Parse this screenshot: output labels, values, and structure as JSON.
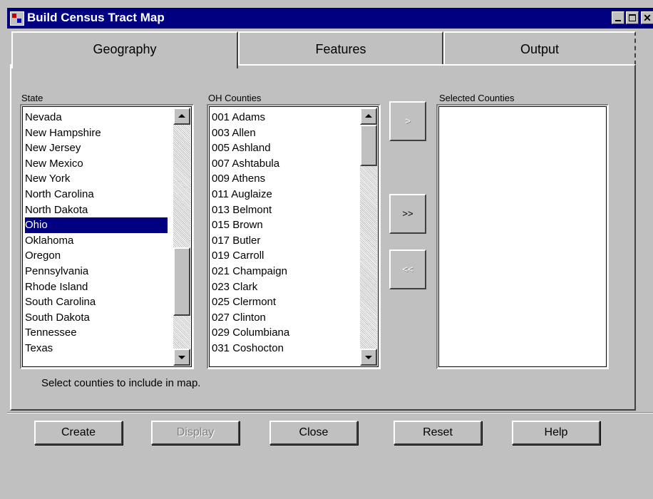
{
  "window": {
    "title": "Build Census Tract Map"
  },
  "tabs": [
    {
      "label": "Geography",
      "active": true
    },
    {
      "label": "Features",
      "active": false
    },
    {
      "label": "Output",
      "active": false
    }
  ],
  "state_group": {
    "label": "State",
    "items": [
      "Nevada",
      "New Hampshire",
      "New Jersey",
      "New Mexico",
      "New York",
      "North Carolina",
      "North Dakota",
      "Ohio",
      "Oklahoma",
      "Oregon",
      "Pennsylvania",
      "Rhode Island",
      "South Carolina",
      "South Dakota",
      "Tennessee",
      "Texas"
    ],
    "selected": "Ohio"
  },
  "counties_group": {
    "label": "OH Counties",
    "items": [
      "001 Adams",
      "003 Allen",
      "005 Ashland",
      "007 Ashtabula",
      "009 Athens",
      "011 Auglaize",
      "013 Belmont",
      "015 Brown",
      "017 Butler",
      "019 Carroll",
      "021 Champaign",
      "023 Clark",
      "025 Clermont",
      "027 Clinton",
      "029 Columbiana",
      "031 Coshocton"
    ]
  },
  "selected_counties_group": {
    "label": "Selected Counties",
    "items": []
  },
  "move_buttons": {
    "add_label": ">",
    "add_all_label": ">>",
    "remove_label": "<<"
  },
  "hint": "Select counties to include in map.",
  "commands": {
    "create": "Create",
    "display": "Display",
    "close": "Close",
    "reset": "Reset",
    "help": "Help"
  },
  "colors": {
    "face": "#c0c0c0",
    "titlebar": "#000080",
    "selection": "#000080"
  }
}
